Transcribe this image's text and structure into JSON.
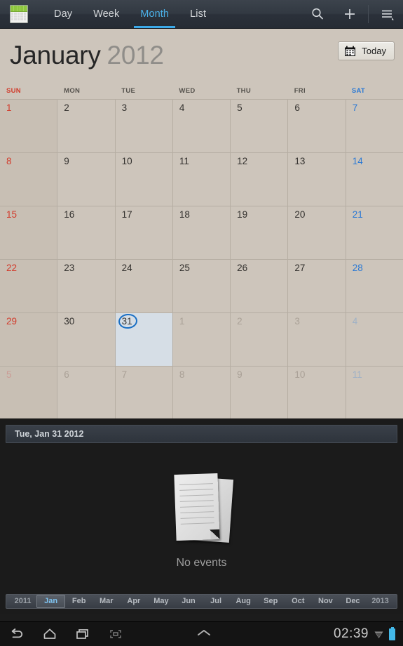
{
  "actionbar": {
    "app_icon": "calendar-app-icon",
    "tabs": [
      {
        "label": "Day",
        "active": false
      },
      {
        "label": "Week",
        "active": false
      },
      {
        "label": "Month",
        "active": true
      },
      {
        "label": "List",
        "active": false
      }
    ],
    "actions": [
      {
        "name": "search-icon"
      },
      {
        "name": "add-event-icon"
      },
      {
        "name": "overflow-menu-icon"
      }
    ],
    "accent_color": "#3ba9e8"
  },
  "calendar": {
    "month_name": "January",
    "year": "2012",
    "today_button": "Today",
    "day_headers": [
      "SUN",
      "MON",
      "TUE",
      "WED",
      "THU",
      "FRI",
      "SAT"
    ],
    "sunday_color": "#d03c2c",
    "saturday_color": "#2b79d4",
    "weeks": [
      [
        {
          "d": "1",
          "out": false,
          "sel": false
        },
        {
          "d": "2",
          "out": false,
          "sel": false
        },
        {
          "d": "3",
          "out": false,
          "sel": false
        },
        {
          "d": "4",
          "out": false,
          "sel": false
        },
        {
          "d": "5",
          "out": false,
          "sel": false
        },
        {
          "d": "6",
          "out": false,
          "sel": false
        },
        {
          "d": "7",
          "out": false,
          "sel": false
        }
      ],
      [
        {
          "d": "8",
          "out": false,
          "sel": false
        },
        {
          "d": "9",
          "out": false,
          "sel": false
        },
        {
          "d": "10",
          "out": false,
          "sel": false
        },
        {
          "d": "11",
          "out": false,
          "sel": false
        },
        {
          "d": "12",
          "out": false,
          "sel": false
        },
        {
          "d": "13",
          "out": false,
          "sel": false
        },
        {
          "d": "14",
          "out": false,
          "sel": false
        }
      ],
      [
        {
          "d": "15",
          "out": false,
          "sel": false
        },
        {
          "d": "16",
          "out": false,
          "sel": false
        },
        {
          "d": "17",
          "out": false,
          "sel": false
        },
        {
          "d": "18",
          "out": false,
          "sel": false
        },
        {
          "d": "19",
          "out": false,
          "sel": false
        },
        {
          "d": "20",
          "out": false,
          "sel": false
        },
        {
          "d": "21",
          "out": false,
          "sel": false
        }
      ],
      [
        {
          "d": "22",
          "out": false,
          "sel": false
        },
        {
          "d": "23",
          "out": false,
          "sel": false
        },
        {
          "d": "24",
          "out": false,
          "sel": false
        },
        {
          "d": "25",
          "out": false,
          "sel": false
        },
        {
          "d": "26",
          "out": false,
          "sel": false
        },
        {
          "d": "27",
          "out": false,
          "sel": false
        },
        {
          "d": "28",
          "out": false,
          "sel": false
        }
      ],
      [
        {
          "d": "29",
          "out": false,
          "sel": false
        },
        {
          "d": "30",
          "out": false,
          "sel": false
        },
        {
          "d": "31",
          "out": false,
          "sel": true
        },
        {
          "d": "1",
          "out": true,
          "sel": false
        },
        {
          "d": "2",
          "out": true,
          "sel": false
        },
        {
          "d": "3",
          "out": true,
          "sel": false
        },
        {
          "d": "4",
          "out": true,
          "sel": false
        }
      ],
      [
        {
          "d": "5",
          "out": true,
          "sel": false
        },
        {
          "d": "6",
          "out": true,
          "sel": false
        },
        {
          "d": "7",
          "out": true,
          "sel": false
        },
        {
          "d": "8",
          "out": true,
          "sel": false
        },
        {
          "d": "9",
          "out": true,
          "sel": false
        },
        {
          "d": "10",
          "out": true,
          "sel": false
        },
        {
          "d": "11",
          "out": true,
          "sel": false
        }
      ]
    ]
  },
  "agenda": {
    "header_date": "Tue, Jan 31 2012",
    "empty_label": "No events",
    "empty_icon": "documents-icon"
  },
  "month_strip": {
    "items": [
      {
        "label": "2011",
        "type": "year",
        "selected": false
      },
      {
        "label": "Jan",
        "type": "month",
        "selected": true
      },
      {
        "label": "Feb",
        "type": "month",
        "selected": false
      },
      {
        "label": "Mar",
        "type": "month",
        "selected": false
      },
      {
        "label": "Apr",
        "type": "month",
        "selected": false
      },
      {
        "label": "May",
        "type": "month",
        "selected": false
      },
      {
        "label": "Jun",
        "type": "month",
        "selected": false
      },
      {
        "label": "Jul",
        "type": "month",
        "selected": false
      },
      {
        "label": "Aug",
        "type": "month",
        "selected": false
      },
      {
        "label": "Sep",
        "type": "month",
        "selected": false
      },
      {
        "label": "Oct",
        "type": "month",
        "selected": false
      },
      {
        "label": "Nov",
        "type": "month",
        "selected": false
      },
      {
        "label": "Dec",
        "type": "month",
        "selected": false
      },
      {
        "label": "2013",
        "type": "year",
        "selected": false
      }
    ]
  },
  "navbar": {
    "buttons": [
      {
        "name": "back-icon"
      },
      {
        "name": "home-icon"
      },
      {
        "name": "recent-apps-icon"
      },
      {
        "name": "screenshot-icon"
      }
    ],
    "chevron": "chevron-up-icon",
    "clock": "02:39",
    "wifi_icon": "wifi-icon",
    "battery_icon": "battery-icon",
    "battery_color": "#43b8e8"
  }
}
